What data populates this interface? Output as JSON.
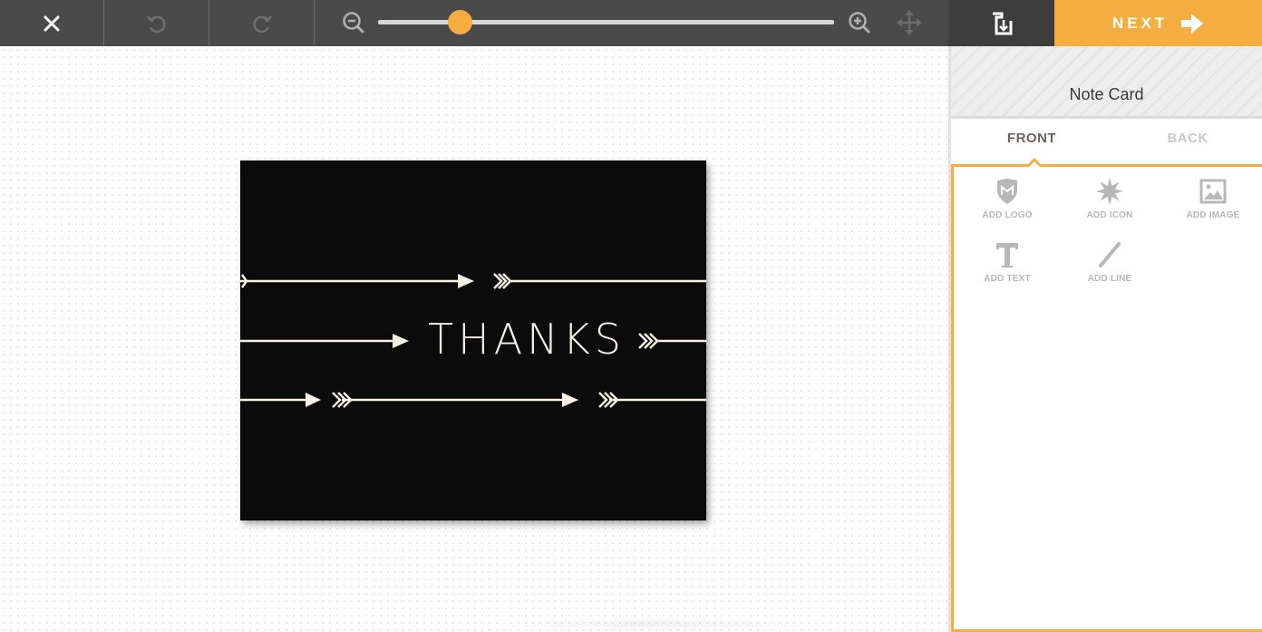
{
  "toolbar": {
    "close_icon": "close-icon",
    "undo_icon": "undo-icon",
    "redo_icon": "redo-icon",
    "zoom_out_icon": "zoom-out-icon",
    "zoom_in_icon": "zoom-in-icon",
    "move_icon": "move-arrows-icon",
    "zoom_level": 0.18,
    "logo_icon": "brand-logo-icon",
    "next_label": "NEXT",
    "next_icon": "arrow-right-icon"
  },
  "colors": {
    "accent": "#f5ad42",
    "toolbar_bg": "#4a4a4a",
    "card_bg": "#0b0b0b",
    "card_ink": "#f6f1e3"
  },
  "card": {
    "headline": "THANKS"
  },
  "panel": {
    "title": "Note Card",
    "tabs": [
      {
        "label": "FRONT",
        "active": true
      },
      {
        "label": "BACK",
        "active": false
      }
    ],
    "tools": [
      {
        "label": "ADD LOGO",
        "icon": "logo-shield-icon"
      },
      {
        "label": "ADD ICON",
        "icon": "starburst-icon"
      },
      {
        "label": "ADD IMAGE",
        "icon": "image-icon"
      },
      {
        "label": "ADD TEXT",
        "icon": "text-t-icon"
      },
      {
        "label": "ADD LINE",
        "icon": "line-icon"
      }
    ]
  }
}
